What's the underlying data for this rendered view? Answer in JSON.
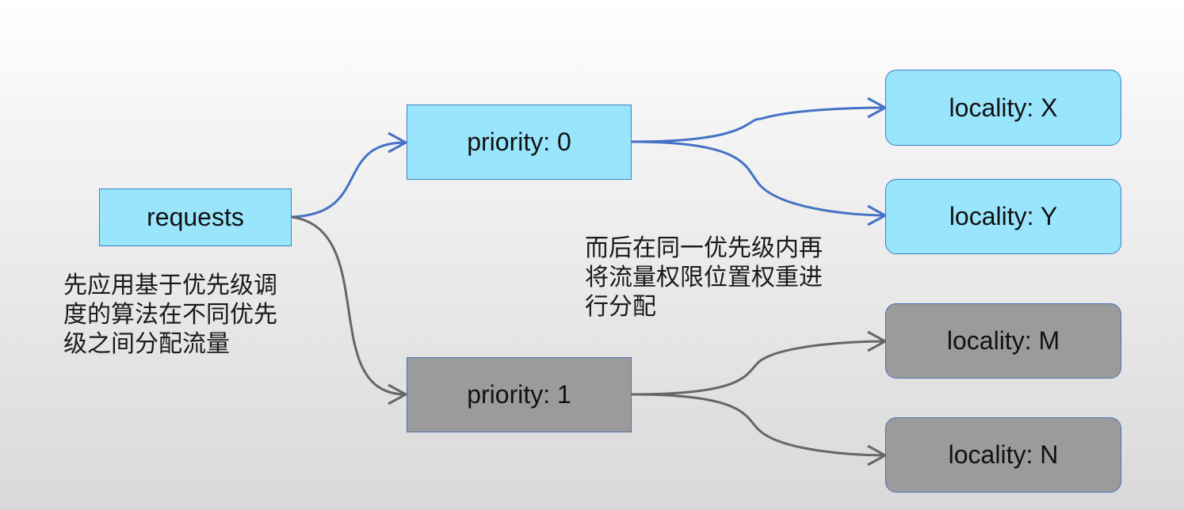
{
  "nodes": {
    "requests": "requests",
    "priority_0": "priority: 0",
    "priority_1": "priority: 1",
    "locality_x": "locality: X",
    "locality_y": "locality: Y",
    "locality_m": "locality: M",
    "locality_n": "locality: N"
  },
  "notes": {
    "left": [
      "先应用基于优先级调",
      "度的算法在不同优先",
      "级之间分配流量"
    ],
    "middle": [
      "而后在同一优先级内再",
      "将流量权限位置权重进",
      "行分配"
    ]
  },
  "colors": {
    "blue_node": "#99e5fb",
    "gray_node": "#9b9b9b",
    "blue_edge": "#4472c4",
    "gray_edge": "#666666"
  }
}
